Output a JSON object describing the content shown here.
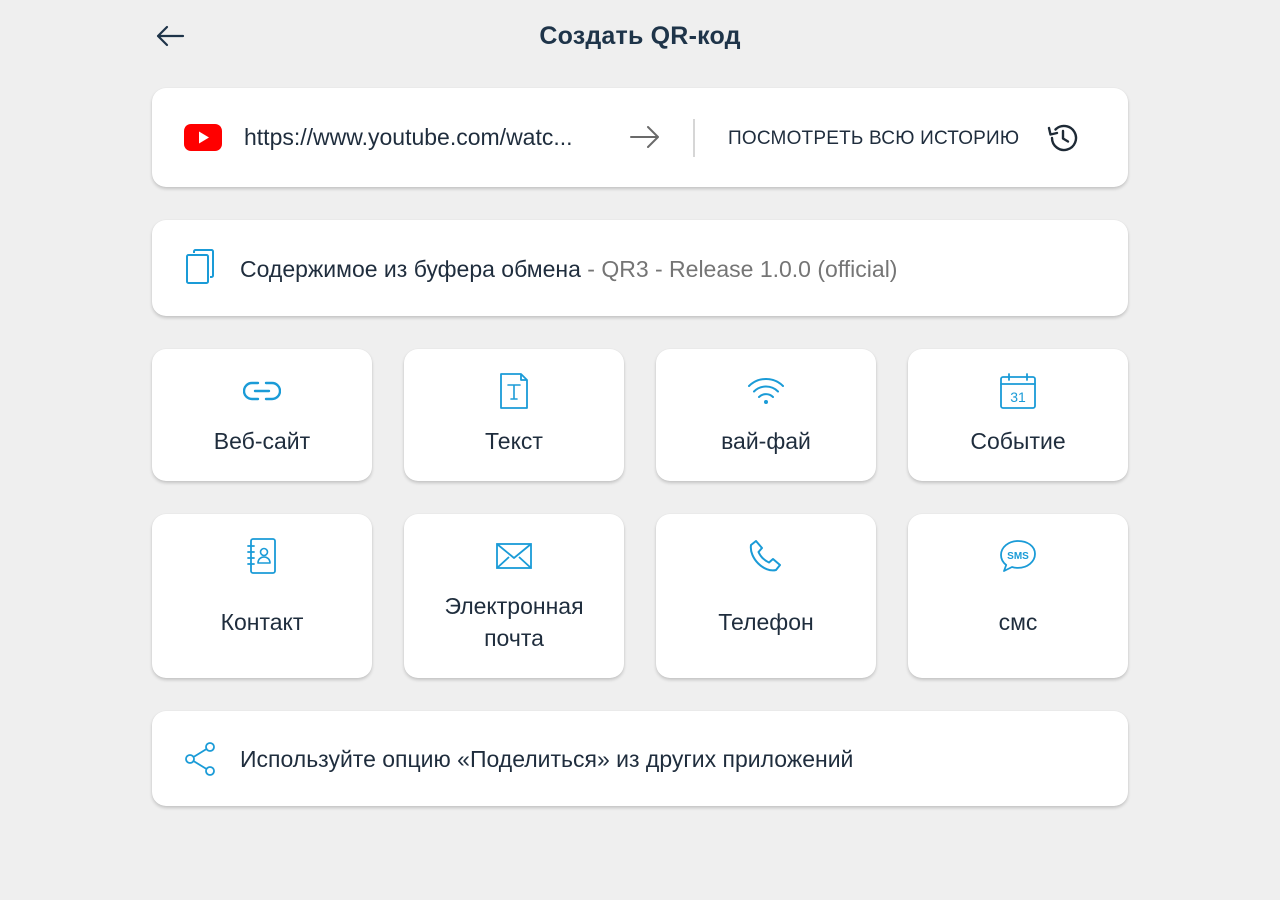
{
  "header": {
    "title": "Создать QR-код",
    "back_icon": "arrow-left-icon"
  },
  "history": {
    "source_icon": "youtube-icon",
    "last_url": "https://www.youtube.com/watc...",
    "open_icon": "arrow-right-icon",
    "view_all_label": "ПОСМОТРЕТЬ ВСЮ ИСТОРИЮ",
    "history_icon": "history-clock-icon"
  },
  "clipboard": {
    "icon": "clipboard-copy-icon",
    "label": "Содержимое из буфера обмена",
    "separator": " - ",
    "value": "QR3 - Release 1.0.0 (official)"
  },
  "types": [
    {
      "label": "Веб-сайт",
      "icon": "link-icon"
    },
    {
      "label": "Текст",
      "icon": "text-document-icon"
    },
    {
      "label": "вай-фай",
      "icon": "wifi-icon"
    },
    {
      "label": "Событие",
      "icon": "calendar-icon",
      "icon_text": "31"
    },
    {
      "label": "Контакт",
      "icon": "contact-book-icon"
    },
    {
      "label_line1": "Электронная",
      "label_line2": "почта",
      "icon": "envelope-icon"
    },
    {
      "label": "Телефон",
      "icon": "phone-icon"
    },
    {
      "label": "смс",
      "icon": "sms-bubble-icon",
      "icon_text": "SMS"
    }
  ],
  "share": {
    "icon": "share-icon",
    "label": "Используйте опцию «Поделиться» из других приложений"
  },
  "colors": {
    "background": "#efefef",
    "card": "#ffffff",
    "accent": "#1a9bd7",
    "text": "#1f2d3d",
    "muted": "#757575",
    "youtube": "#ff0000"
  }
}
